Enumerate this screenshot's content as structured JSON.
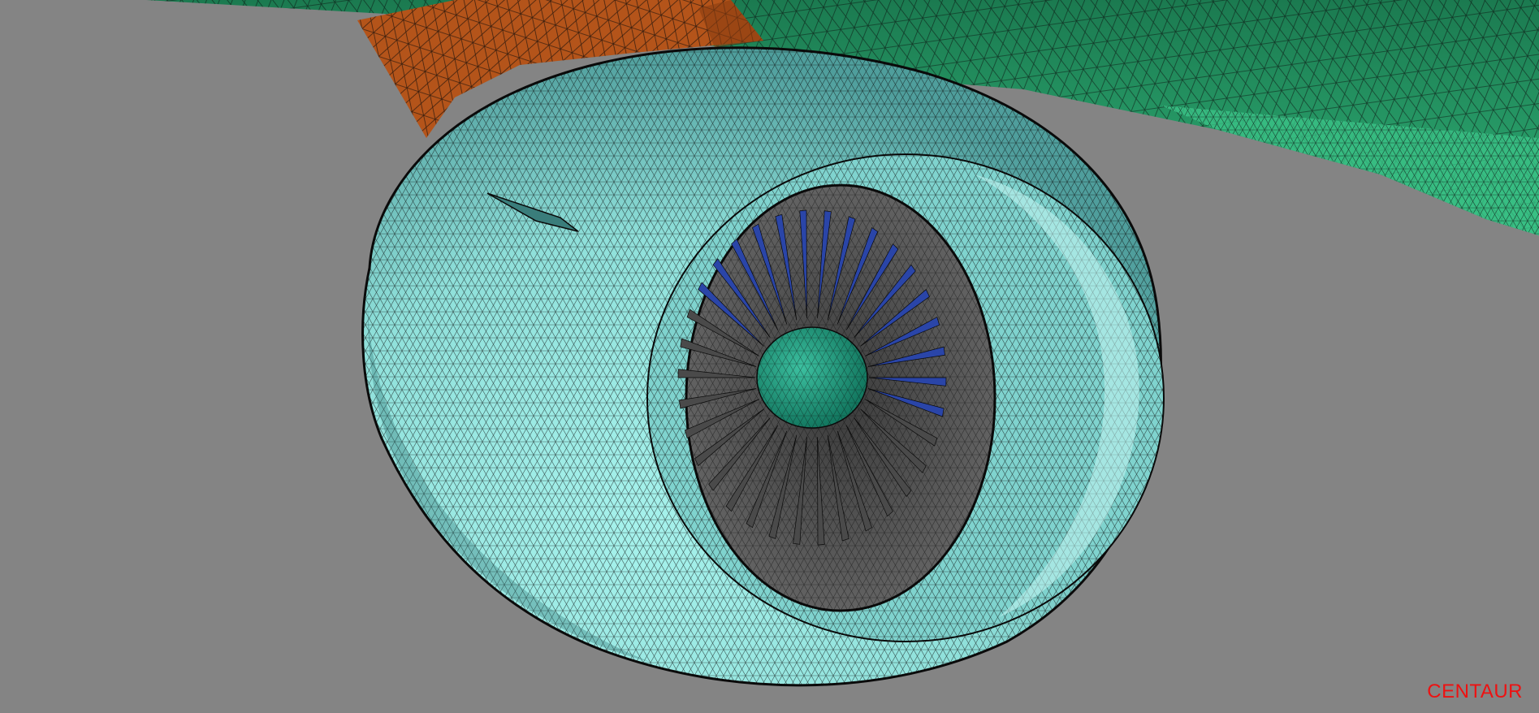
{
  "watermark": {
    "text": "CENTAUR"
  },
  "colors": {
    "background": "#848484",
    "wing": "#1f8a5a",
    "wing_light": "#3fbf84",
    "pylon": "#b4541a",
    "nacelle": "#8fe6e0",
    "nacelle_shadow": "#4aa6a6",
    "inlet_interior": "#5a5a5a",
    "fan_blades": "#2a45a8",
    "spinner": "#2fa088",
    "mesh_lines": "#0a0a0a",
    "watermark": "#ee1111"
  }
}
